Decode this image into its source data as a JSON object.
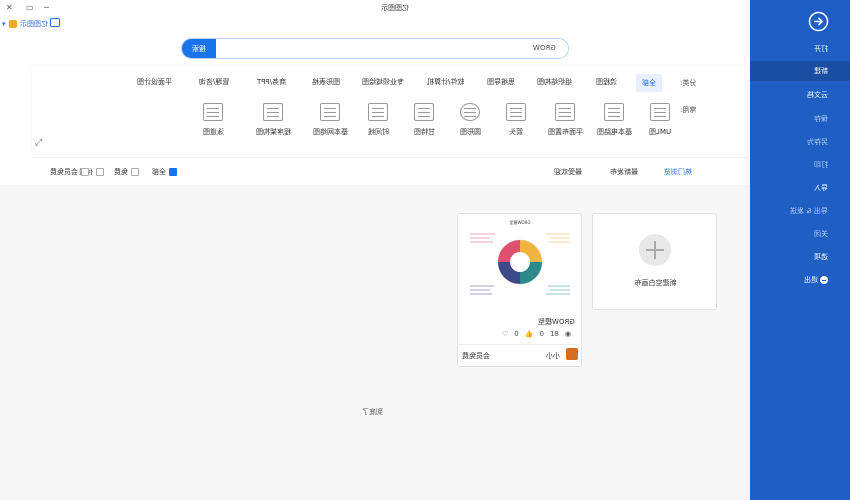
{
  "titlebar": {
    "title": "亿图图示",
    "min": "─",
    "restore": "▭",
    "close": "✕"
  },
  "brand": {
    "name": "亿图图示"
  },
  "search": {
    "button": "搜索",
    "value": "GROW"
  },
  "category": {
    "label_class": "分类:",
    "label_common": "常用:",
    "tabs": [
      "全部",
      "流程图",
      "组织结构图",
      "思维导图",
      "软件/计算机",
      "专业领域绘图",
      "图形表格",
      "商务/PPT",
      "管理/咨询",
      "平面设计图"
    ],
    "icons": [
      "UML图",
      "基本电路图",
      "平面布置图",
      "箭头",
      "圆形图",
      "甘特图",
      "时间线",
      "基本网络图",
      "程序架构图",
      "泳道图"
    ]
  },
  "sort": {
    "tabs": [
      "热门浏览",
      "最新发布",
      "最受欢迎"
    ]
  },
  "filters": {
    "items": [
      "全部",
      "免费",
      "付费",
      "会员免费"
    ]
  },
  "cards": {
    "new_blank": "新建空白画布",
    "template": {
      "name": "GROW模型",
      "views": "18",
      "likes": "0",
      "favs": "0",
      "author": "小小",
      "badge": "会员免费",
      "thumb_title": "GROW模型"
    }
  },
  "endtext": "到底了",
  "sidebar": {
    "items": [
      {
        "label": "打开",
        "state": "normal"
      },
      {
        "label": "新建",
        "state": "active"
      },
      {
        "label": "云文档",
        "state": "normal"
      },
      {
        "label": "保存",
        "state": "dim"
      },
      {
        "label": "另存为",
        "state": "dim"
      },
      {
        "label": "打印",
        "state": "dim"
      },
      {
        "label": "导入",
        "state": "normal"
      },
      {
        "label": "导出 & 发送",
        "state": "dim"
      },
      {
        "label": "关闭",
        "state": "dim"
      },
      {
        "label": "选项",
        "state": "normal"
      },
      {
        "label": "退出",
        "state": "normal"
      }
    ]
  },
  "colors": {
    "accent": "#1a73e8",
    "sidebar": "#1f5fc4",
    "sidebar_active": "#1a4ea3"
  }
}
